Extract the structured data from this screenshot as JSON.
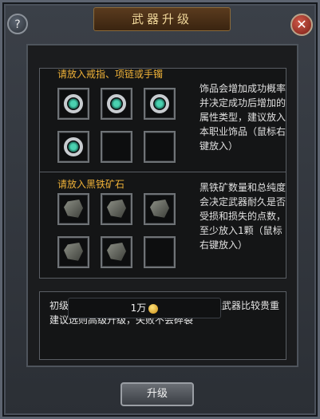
{
  "window": {
    "title": "武器升级"
  },
  "controls": {
    "help_label": "?",
    "close_label": "✕"
  },
  "ring_section": {
    "label": "请放入戒指、项链或手镯",
    "description": "饰品会增加成功概率并决定成功后增加的属性类型，建议放入本职业饰品（鼠标右键放入）",
    "slots": [
      "ring",
      "ring",
      "ring",
      "ring",
      "empty",
      "empty"
    ]
  },
  "ore_section": {
    "label": "请放入黑铁矿石",
    "description": "黑铁矿数量和总纯度会决定武器耐久是否受损和损失的点数，至少放入1颗（鼠标右键放入）",
    "slots": [
      "ore",
      "ore",
      "ore",
      "ore",
      "ore",
      "empty"
    ]
  },
  "notice": {
    "text": "初级升级一旦失败武器会直接碎裂，如果武器比较贵重建议选则高级升级，失败不会碎裂"
  },
  "cost": {
    "amount": "1万",
    "icon": "gold-coin-icon"
  },
  "actions": {
    "upgrade_label": "升级"
  },
  "colors": {
    "label": "#f0b238",
    "title": "#f0d79a"
  }
}
